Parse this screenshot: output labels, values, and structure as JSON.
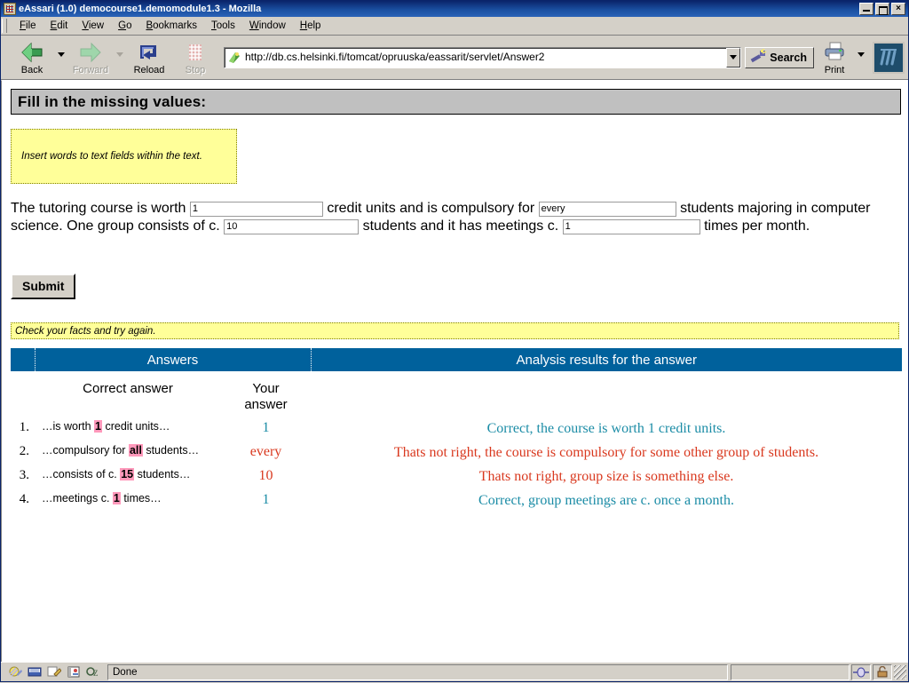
{
  "window": {
    "title": "eAssari (1.0) democourse1.demomodule1.3 - Mozilla",
    "icon": "app-icon",
    "minimize_label": "",
    "maximize_label": "",
    "close_label": "×"
  },
  "menubar": {
    "items": [
      {
        "label": "File",
        "accesskey": "F"
      },
      {
        "label": "Edit",
        "accesskey": "E"
      },
      {
        "label": "View",
        "accesskey": "V"
      },
      {
        "label": "Go",
        "accesskey": "G"
      },
      {
        "label": "Bookmarks",
        "accesskey": "B"
      },
      {
        "label": "Tools",
        "accesskey": "T"
      },
      {
        "label": "Window",
        "accesskey": "W"
      },
      {
        "label": "Help",
        "accesskey": "H"
      }
    ]
  },
  "toolbar": {
    "back_label": "Back",
    "forward_label": "Forward",
    "reload_label": "Reload",
    "stop_label": "Stop",
    "search_label": "Search",
    "print_label": "Print",
    "url_value": "http://db.cs.helsinki.fi/tomcat/opruuska/eassarit/servlet/Answer2",
    "url_placeholder": "Enter address"
  },
  "page": {
    "banner_title": "Fill in the missing values:",
    "instruction": "Insert words to text fields within the text.",
    "exercise": {
      "part1": "The tutoring course is worth",
      "part2": "credit units and is compulsory for",
      "part3": "students majoring in computer science. One group consists of c.",
      "part4": "students and it has meetings c.",
      "part5": "times per month.",
      "field1_value": "1",
      "field2_value": "every",
      "field3_value": "10",
      "field4_value": "1"
    },
    "submit_label": "Submit",
    "feedback": "Check your facts and try again."
  },
  "results": {
    "header_answers": "Answers",
    "header_analysis": "Analysis results for the answer",
    "sub_correct": "Correct answer",
    "sub_your_line1": "Your",
    "sub_your_line2": "answer",
    "rows": [
      {
        "num": "1.",
        "correct_pre": "…is worth ",
        "correct_hl": "1",
        "correct_post": " credit units…",
        "your_answer": "1",
        "your_status": "ok",
        "analysis": "Correct, the course is worth 1 credit units.",
        "analysis_status": "ok"
      },
      {
        "num": "2.",
        "correct_pre": "…compulsory for ",
        "correct_hl": "all",
        "correct_post": " students…",
        "your_answer": "every",
        "your_status": "bad",
        "analysis": "Thats not right, the course is compulsory for some other group of students.",
        "analysis_status": "bad"
      },
      {
        "num": "3.",
        "correct_pre": "…consists of c. ",
        "correct_hl": "15",
        "correct_post": " students…",
        "your_answer": "10",
        "your_status": "bad",
        "analysis": "Thats not right, group size is something else.",
        "analysis_status": "bad"
      },
      {
        "num": "4.",
        "correct_pre": "…meetings c. ",
        "correct_hl": "1",
        "correct_post": " times…",
        "your_answer": "1",
        "your_status": "ok",
        "analysis": "Correct, group meetings are c. once a month.",
        "analysis_status": "ok"
      }
    ]
  },
  "statusbar": {
    "status_text": "Done",
    "progress_text": "",
    "icons": [
      "composer-icon",
      "mail-icon",
      "editor-icon",
      "addressbook-icon",
      "chatzilla-icon"
    ],
    "right_icons": [
      "network-status-icon",
      "security-lock-icon"
    ]
  },
  "colors": {
    "titlebar": "#0a246a",
    "chrome": "#d4d0c8",
    "table_header": "#00619c",
    "highlight_pink": "#ff99bb",
    "note_yellow": "#ffff99",
    "correct_teal": "#1b8ca6",
    "incorrect_red": "#d9381e"
  }
}
